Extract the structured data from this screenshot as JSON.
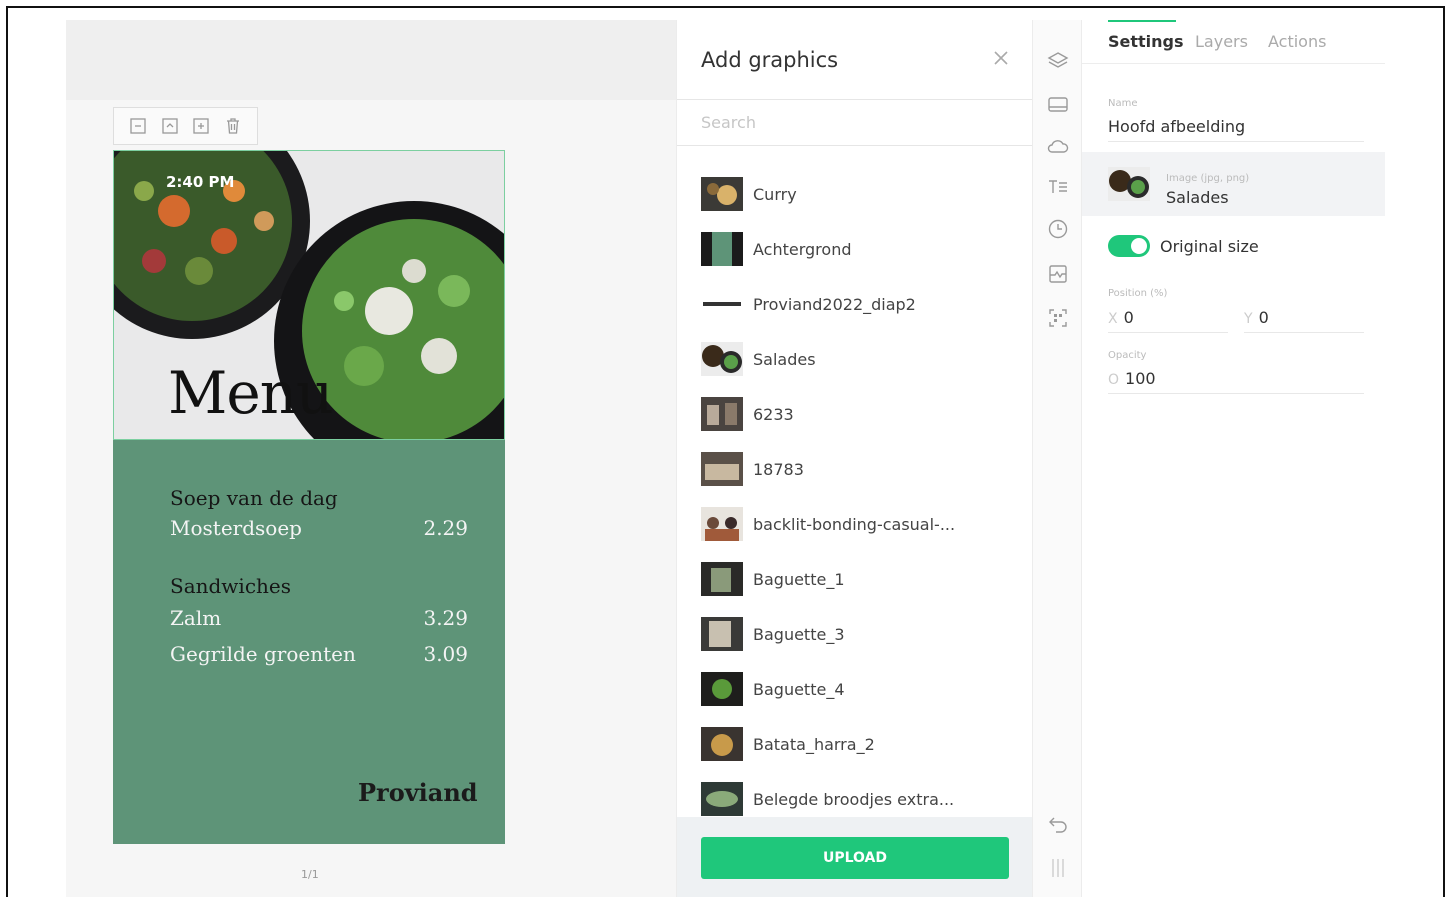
{
  "canvas": {
    "phone_time": "2:40 PM",
    "menu_title": "Menu",
    "sections": [
      {
        "heading": "Soep van de dag",
        "items": [
          {
            "name": "Mosterdsoep",
            "price": "2.29"
          }
        ]
      },
      {
        "heading": "Sandwiches",
        "items": [
          {
            "name": "Zalm",
            "price": "3.29"
          },
          {
            "name": "Gegrilde groenten",
            "price": "3.09"
          }
        ]
      }
    ],
    "brand": "Proviand",
    "page_indicator": "1/1"
  },
  "graphics_panel": {
    "title": "Add graphics",
    "search_placeholder": "Search",
    "items": [
      {
        "label": "Curry"
      },
      {
        "label": "Achtergrond"
      },
      {
        "label": "Proviand2022_diap2"
      },
      {
        "label": "Salades"
      },
      {
        "label": "6233"
      },
      {
        "label": "18783"
      },
      {
        "label": "backlit-bonding-casual-..."
      },
      {
        "label": "Baguette_1"
      },
      {
        "label": "Baguette_3"
      },
      {
        "label": "Baguette_4"
      },
      {
        "label": "Batata_harra_2"
      },
      {
        "label": "Belegde broodjes extra..."
      }
    ],
    "upload_label": "UPLOAD"
  },
  "settings": {
    "tabs": [
      "Settings",
      "Layers",
      "Actions"
    ],
    "name_label": "Name",
    "name_value": "Hoofd afbeelding",
    "image_label": "Image (jpg, png)",
    "image_value": "Salades",
    "original_size_label": "Original size",
    "original_size_on": true,
    "position_label": "Position (%)",
    "x_label": "X",
    "x_value": "0",
    "y_label": "Y",
    "y_value": "0",
    "opacity_label": "Opacity",
    "opacity_prefix": "O",
    "opacity_value": "100"
  },
  "colors": {
    "accent": "#1fc77b",
    "menu_green": "#5e9478"
  },
  "icons": [
    "layers-icon",
    "screen-icon",
    "cloud-icon",
    "text-icon",
    "clock-icon",
    "image-icon",
    "qr-scan-icon",
    "undo-icon",
    "drag-handle-icon"
  ]
}
